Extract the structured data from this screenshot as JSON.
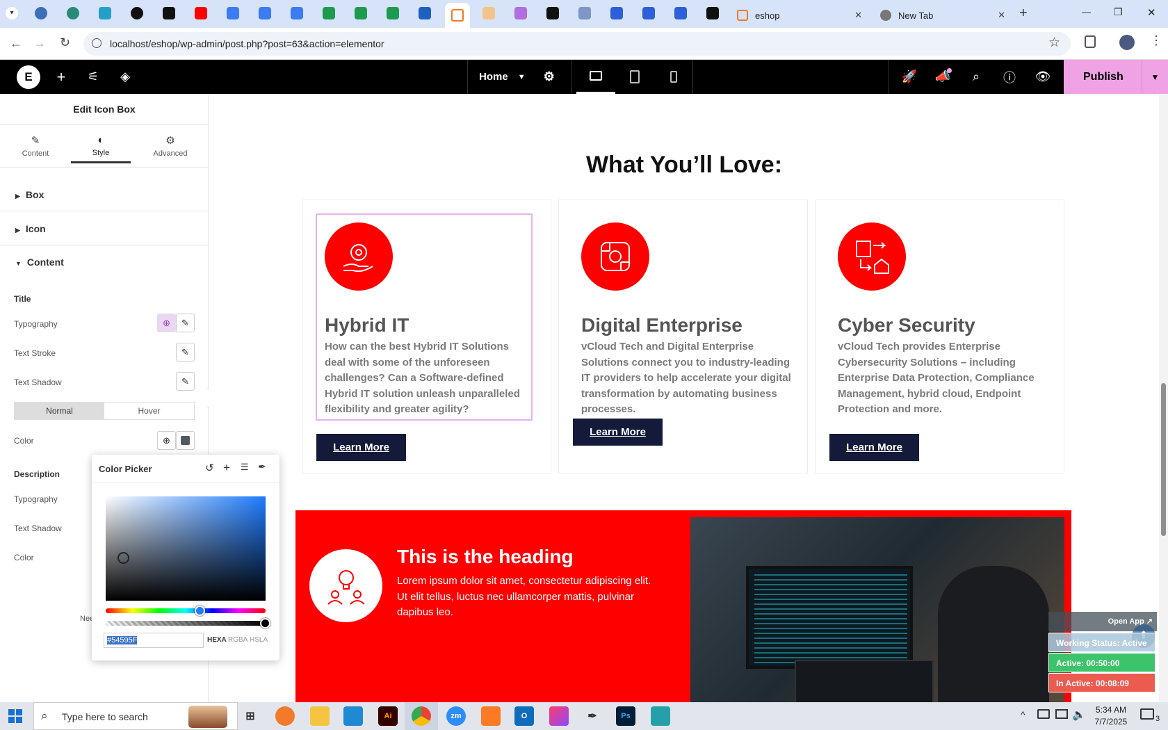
{
  "browser": {
    "tabs_active": [
      {
        "title": "eshop",
        "close": "✕"
      },
      {
        "title": "New Tab",
        "close": "✕"
      }
    ],
    "new_tab": "+",
    "url": "localhost/eshop/wp-admin/post.php?post=63&action=elementor",
    "window_controls": [
      "—",
      "❐",
      "✕"
    ]
  },
  "elementor_top": {
    "page_select": "Home",
    "publish_label": "Publish"
  },
  "panel": {
    "title": "Edit Icon Box",
    "tabs": [
      "Content",
      "Style",
      "Advanced"
    ],
    "sections": [
      "Box",
      "Icon",
      "Content"
    ],
    "title_group": "Title",
    "rows": [
      "Typography",
      "Text Stroke",
      "Text Shadow"
    ],
    "state_toggle": [
      "Normal",
      "Hover"
    ],
    "color_label": "Color",
    "description_group": "Description",
    "desc_rows": [
      "Typography",
      "Text Shadow",
      "Color"
    ],
    "need_help_partial": "Nee"
  },
  "color_picker": {
    "title": "Color Picker",
    "hex_value": "#54595F",
    "modes": [
      "HEXA",
      "RGBA",
      "HSLA"
    ]
  },
  "canvas": {
    "section_heading": "What You’ll Love:",
    "cards": [
      {
        "title": "Hybrid IT",
        "desc": "How can the best Hybrid IT Solutions deal with some of the unforeseen challenges? Can a Software-defined Hybrid IT solution unleash unparalleled flexibility and greater agility?",
        "button": "Learn More"
      },
      {
        "title": "Digital Enterprise",
        "desc": "vCloud Tech and Digital Enterprise Solutions connect you to industry-leading IT providers to help accelerate your digital transformation by automating business processes.",
        "button": "Learn More"
      },
      {
        "title": "Cyber Security",
        "desc": "vCloud Tech provides Enterprise Cybersecurity Solutions – including Enterprise Data Protection, Compliance Management, hybrid cloud, Endpoint Protection and more.",
        "button": "Learn More"
      }
    ],
    "banner": {
      "heading": "This is the heading",
      "text": "Lorem ipsum dolor sit amet, consectetur adipiscing elit. Ut elit tellus, luctus nec ullamcorper mattis, pulvinar dapibus leo."
    }
  },
  "widget": {
    "open_app": "Open App ↗",
    "working_status": "Working Status: Active",
    "active": "Active: 00:50:00",
    "inactive": "In Active: 00:08:09"
  },
  "taskbar": {
    "search_placeholder": "Type here to search",
    "time": "5:34 AM",
    "date": "7/7/2025",
    "notif_count": "3"
  },
  "colors": {
    "accent_red": "#ff0000",
    "navy": "#141a3a",
    "publish_pink": "#f0a3e4"
  }
}
